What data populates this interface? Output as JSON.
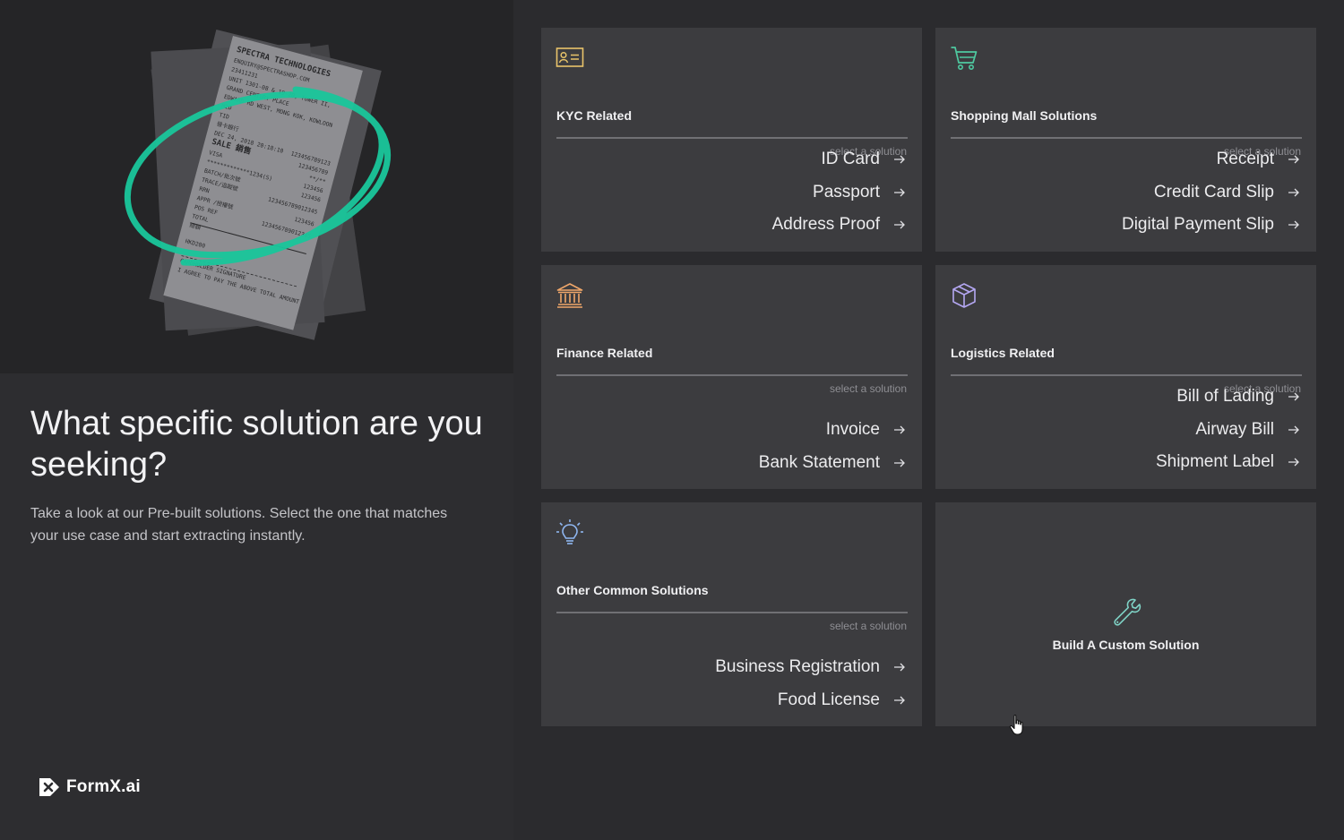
{
  "left": {
    "headline": "What specific solution are you seeking?",
    "description": "Take a look at our Pre-built solutions. Select the one that matches your use case and start extracting instantly.",
    "logo_text": "FormX.ai",
    "receipt": {
      "lines": [
        "SPECTRA TECHNOLOGIES",
        "ENQUIRY@SPECTRASHOP.COM",
        "23411231",
        "UNIT 1301-08 & 19-20, TOWER II,",
        "GRAND CENTURY PLACE",
        "EDWARD RD WEST, MONG KOK, KOWLOON",
        "MID",
        "TID",
        "發卡銀行",
        "DEC 24, 2018 20:18:10",
        "SALE 銷售",
        "VISA",
        "*************1234(S)",
        "BATCH/批次號",
        "TRACE/追蹤號",
        "RRN",
        "APPR /授權號",
        "POS REF",
        "TOTAL",
        "總額",
        "HKD200",
        "CARDHOLDER SIGNATURE",
        "I AGREE TO PAY THE ABOVE TOTAL AMOUNT"
      ],
      "values": [
        "123456789123",
        "123456789",
        "**/**",
        "123456",
        "123456",
        "123456789012345",
        "123456",
        "123456789012345"
      ]
    }
  },
  "hint_text": "select a solution",
  "colors": {
    "accent_green": "#19c69b",
    "icon_yellow": "#e9c46a",
    "icon_green": "#4ec9a0",
    "icon_orange": "#f0a76a",
    "icon_purple": "#b4a7f2",
    "icon_blue": "#8fb6f0",
    "icon_teal": "#7fd3c6"
  },
  "cards": [
    {
      "title": "KYC Related",
      "icon": "id-card-icon",
      "options": [
        "ID Card",
        "Passport",
        "Address Proof"
      ]
    },
    {
      "title": "Shopping Mall Solutions",
      "icon": "shopping-cart-icon",
      "options": [
        "Receipt",
        "Credit Card Slip",
        "Digital Payment Slip"
      ]
    },
    {
      "title": "Finance Related",
      "icon": "bank-icon",
      "options": [
        "Invoice",
        "Bank Statement"
      ]
    },
    {
      "title": "Logistics Related",
      "icon": "package-icon",
      "options": [
        "Bill of Lading",
        "Airway Bill",
        "Shipment Label"
      ]
    },
    {
      "title": "Other Common Solutions",
      "icon": "lightbulb-icon",
      "options": [
        "Business Registration",
        "Food License"
      ]
    }
  ],
  "custom": {
    "label": "Build A Custom Solution",
    "icon": "wrench-icon"
  }
}
